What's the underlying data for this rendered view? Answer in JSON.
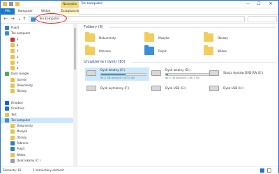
{
  "titlebar": {
    "contextual_tab": "Narzędzia dysku",
    "title": "Ten komputer",
    "minimize": "—",
    "maximize": "☐",
    "close": "✕"
  },
  "ribbon": {
    "tabs": [
      "Plik",
      "Komputer",
      "Widok",
      "Zarządzanie"
    ]
  },
  "navbar": {
    "back": "←",
    "forward": "→",
    "up": "↑",
    "address": "Ten komputer"
  },
  "sidebar": {
    "items": [
      {
        "label": "Pulpit",
        "color": "#2f7ec7"
      },
      {
        "label": "Ten komputer",
        "color": "#3a8fd8"
      },
      {
        "label": "E",
        "color": "#d32f2f"
      },
      {
        "label": "a",
        "color": "#e8c24f"
      },
      {
        "label": "a",
        "color": "#e8c24f"
      },
      {
        "label": "a",
        "color": "#e8c24f"
      },
      {
        "label": "a",
        "color": "#e8c24f"
      },
      {
        "label": "a",
        "color": "#e8c24f"
      },
      {
        "label": "Dysk Google",
        "color": "#4caf50"
      },
      {
        "label": "Garmin",
        "color": "#e8c24f"
      },
      {
        "label": "Dokumenty",
        "color": "#e8c24f"
      },
      {
        "label": "Obrazy",
        "color": "#e8c24f"
      },
      {
        "label": "",
        "color": "#ffffff"
      },
      {
        "label": "Dropbox",
        "color": "#0061fe"
      },
      {
        "label": "OneDrive",
        "color": "#1a73c8"
      },
      {
        "label": "Test",
        "color": "#e8c24f"
      },
      {
        "label": "Ten komputer",
        "color": "#3a8fd8"
      },
      {
        "label": "Dokumenty",
        "color": "#e8c24f"
      },
      {
        "label": "Muzyka",
        "color": "#e8c24f"
      },
      {
        "label": "Obrazy",
        "color": "#e8c24f"
      },
      {
        "label": "Pobrane",
        "color": "#2f7ec7"
      },
      {
        "label": "Pulpit",
        "color": "#2f7ec7"
      },
      {
        "label": "Wideo",
        "color": "#e8c24f"
      },
      {
        "label": "Dysk lokalny (C:)",
        "color": "#9e9e9e"
      }
    ]
  },
  "main": {
    "folders_header": "Foldery (6)",
    "folders": [
      {
        "label": "Dokumenty",
        "color": "#f3cd5c"
      },
      {
        "label": "Muzyka",
        "color": "#f3cd5c"
      },
      {
        "label": "Obrazy",
        "color": "#f3cd5c"
      },
      {
        "label": "Pobrane",
        "color": "#f3cd5c"
      },
      {
        "label": "Pulpit",
        "color": "#3a8fd8"
      },
      {
        "label": "Wideo",
        "color": "#f3cd5c"
      }
    ],
    "drives_header": "Urządzenia i dyski (10)",
    "drives": [
      {
        "label": "Dysk lokalny (C:)",
        "free": "94,2 GB wolnych z 67,5 GB",
        "used_fraction": 0.55,
        "show_bar": true
      },
      {
        "label": "Dysk lokalny (D:)",
        "free": "86,7 GB wolnych z 86,7 GB",
        "used_fraction": 0.05,
        "show_bar": true
      },
      {
        "label": "Stacja dysków DVD RW (E:)",
        "free": "",
        "used_fraction": 0,
        "show_bar": false
      },
      {
        "label": "Dysk wymienny (F:)",
        "free": "",
        "used_fraction": 0,
        "show_bar": false
      },
      {
        "label": "Dysk USB (G:)",
        "free": "",
        "used_fraction": 0,
        "show_bar": false
      },
      {
        "label": "Dysk USB (H:)",
        "free": "",
        "used_fraction": 0,
        "show_bar": false
      }
    ]
  },
  "status": {
    "items_count": "Elementy: 16",
    "selection": "1 zaznaczony element"
  }
}
